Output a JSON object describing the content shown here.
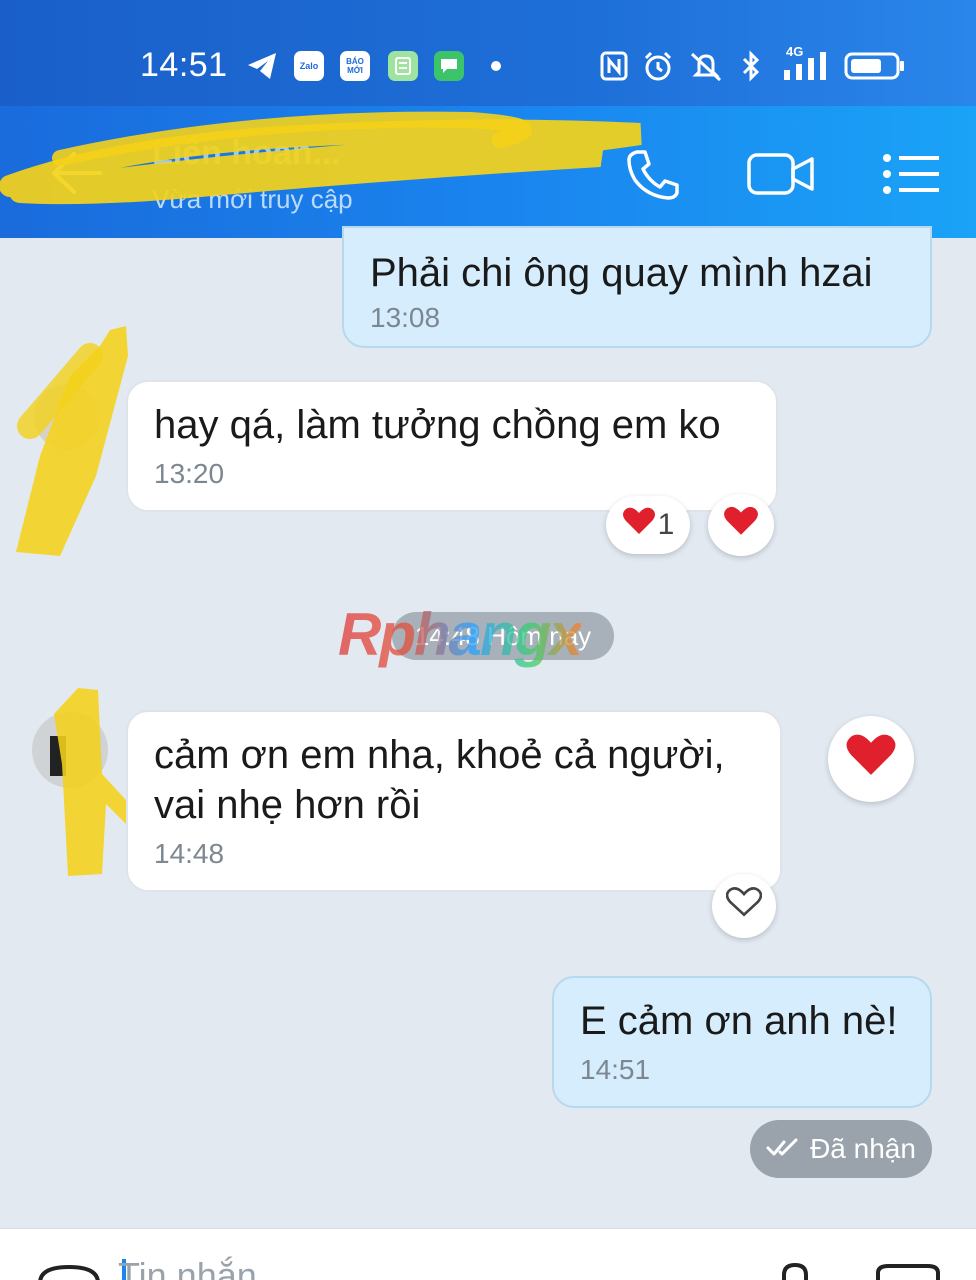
{
  "status_bar": {
    "time": "14:51",
    "app_badges": [
      "Zalo",
      "BÁO MỚI"
    ],
    "network": "4G"
  },
  "header": {
    "title": "Liên hoan...",
    "subtitle": "Vừa mới truy cập",
    "icons": [
      "back-arrow-icon",
      "phone-icon",
      "video-call-icon",
      "menu-icon"
    ]
  },
  "messages": [
    {
      "direction": "out",
      "text": "Phải chi ông quay mình hzai",
      "time": "13:08"
    },
    {
      "direction": "in",
      "text": "hay qá, làm tưởng chồng em ko",
      "time": "13:20",
      "reaction_count": "1"
    },
    {
      "direction": "in",
      "text_line1": "cảm ơn em nha, khoẻ cả người,",
      "text_line2": "vai nhẹ hơn rồi",
      "time": "14:48"
    },
    {
      "direction": "out",
      "text": "E cảm ơn anh nè!",
      "time": "14:51"
    }
  ],
  "date_separator": "14:48 Hôm nay",
  "watermark": "Rphangx",
  "receipt": {
    "label": "Đã nhận"
  },
  "composer": {
    "placeholder": "Tin nhắn"
  },
  "colors": {
    "header": "#1a86ef",
    "out_bubble": "#d5edfc",
    "in_bubble": "#ffffff",
    "background": "#e2e9f1",
    "heart": "#e0202c"
  }
}
